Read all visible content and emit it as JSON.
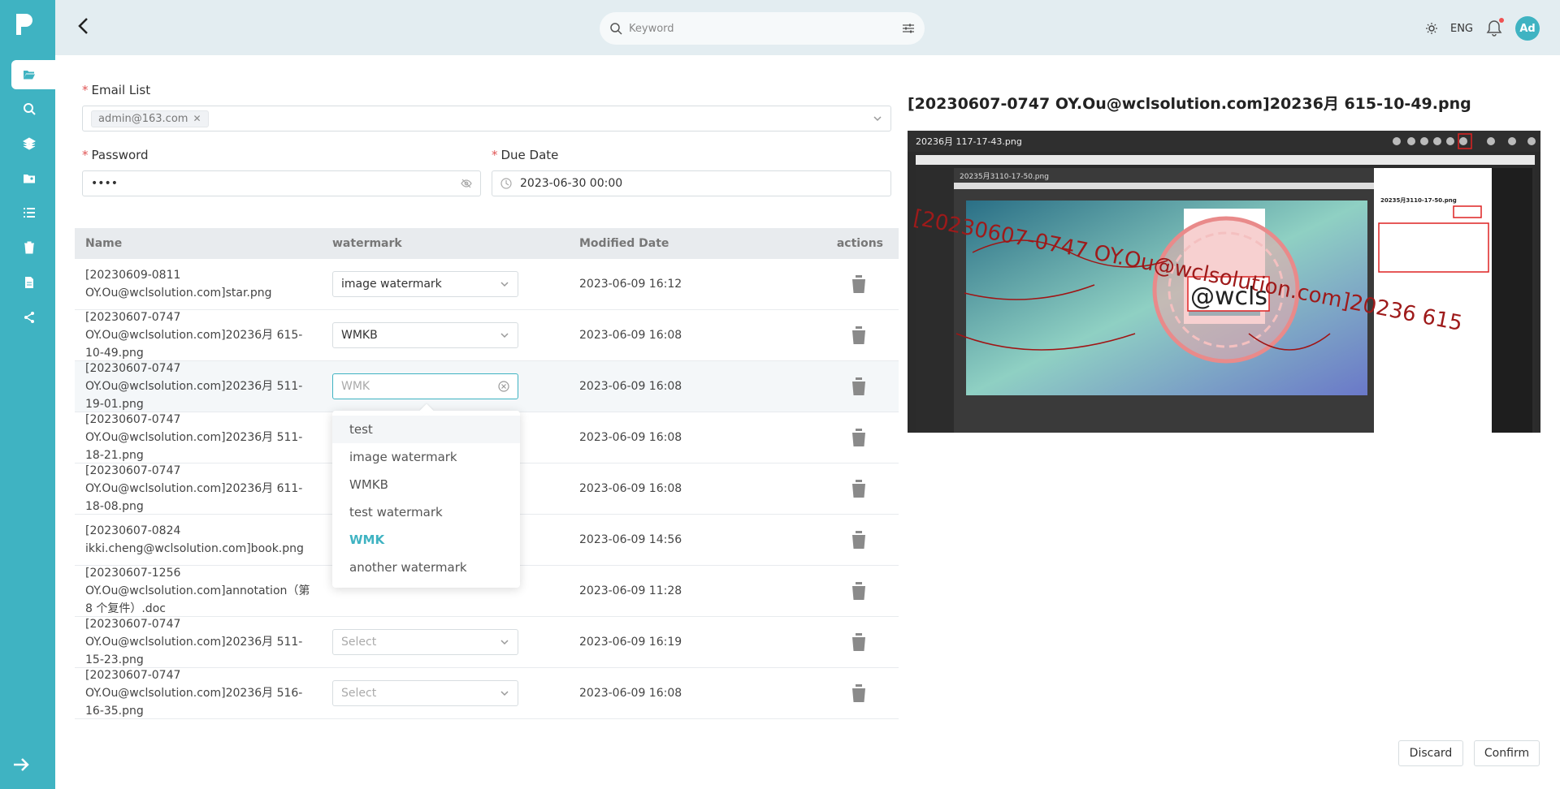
{
  "search": {
    "placeholder": "Keyword"
  },
  "header": {
    "language": "ENG",
    "avatar_initials": "Ad"
  },
  "form": {
    "email_label": "Email List",
    "email_tag": "admin@163.com",
    "password_label": "Password",
    "password_value": "••••",
    "due_date_label": "Due Date",
    "due_date_value": "2023-06-30 00:00",
    "required_mark": "*"
  },
  "table": {
    "headers": {
      "name": "Name",
      "watermark": "watermark",
      "date": "Modified Date",
      "actions": "actions"
    },
    "rows": [
      {
        "name": "[20230609-0811 OY.Ou@wclsolution.com]star.png",
        "watermark": "image watermark",
        "date": "2023-06-09 16:12"
      },
      {
        "name": "[20230607-0747 OY.Ou@wclsolution.com]20236月 615-10-49.png",
        "watermark": "WMKB",
        "date": "2023-06-09 16:08"
      },
      {
        "name": "[20230607-0747 OY.Ou@wclsolution.com]20236月 511-19-01.png",
        "watermark": "WMK",
        "date": "2023-06-09 16:08"
      },
      {
        "name": "[20230607-0747 OY.Ou@wclsolution.com]20236月 511-18-21.png",
        "watermark": "",
        "date": "2023-06-09 16:08"
      },
      {
        "name": "[20230607-0747 OY.Ou@wclsolution.com]20236月 611-18-08.png",
        "watermark": "",
        "date": "2023-06-09 16:08"
      },
      {
        "name": "[20230607-0824 ikki.cheng@wclsolution.com]book.png",
        "watermark": "",
        "date": "2023-06-09 14:56"
      },
      {
        "name": "[20230607-1256 OY.Ou@wclsolution.com]annotation（第 8 个复件）.doc",
        "watermark": "",
        "date": "2023-06-09 11:28"
      },
      {
        "name": "[20230607-0747 OY.Ou@wclsolution.com]20236月 511-15-23.png",
        "watermark": "Select",
        "date": "2023-06-09 16:19"
      },
      {
        "name": "[20230607-0747 OY.Ou@wclsolution.com]20236月 516-16-35.png",
        "watermark": "Select",
        "date": "2023-06-09 16:08"
      }
    ]
  },
  "dropdown": {
    "options": [
      "test",
      "image watermark",
      "WMKB",
      "test watermark",
      "WMK",
      "another watermark"
    ],
    "selected": "WMK",
    "hovered": "test"
  },
  "preview": {
    "title": "[20230607-0747 OY.Ou@wclsolution.com]20236月 615-10-49.png",
    "inner_title": "20236月 117-17-43.png",
    "nested_title": "20235月3110-17-50.png",
    "panel_title": "20235月3110-17-50.png",
    "watermark_text": "[20230607-0747 OY.Ou@wclsolution.com]20236 615",
    "stamp_text": "@wcls"
  },
  "footer": {
    "discard": "Discard",
    "confirm": "Confirm"
  },
  "colors": {
    "accent": "#3fb3c2",
    "required": "#e05555",
    "sidebar": "#3fb3c2",
    "header": "#e3edf1"
  }
}
